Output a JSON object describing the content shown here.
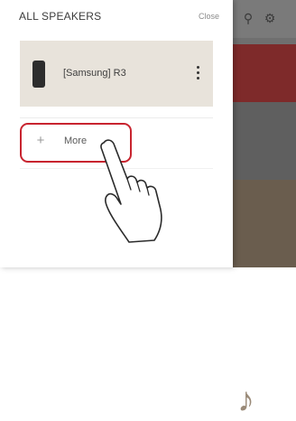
{
  "drawer": {
    "title": "ALL SPEAKERS",
    "close_label": "Close",
    "speakers": [
      {
        "name": "[Samsung] R3"
      }
    ],
    "more_label": "More",
    "more_icon": "plus-icon"
  },
  "background": {
    "icons": [
      "search-icon",
      "settings-icon"
    ]
  },
  "colors": {
    "highlight": "#c8242f",
    "speaker_row_bg": "#e8e3db"
  }
}
